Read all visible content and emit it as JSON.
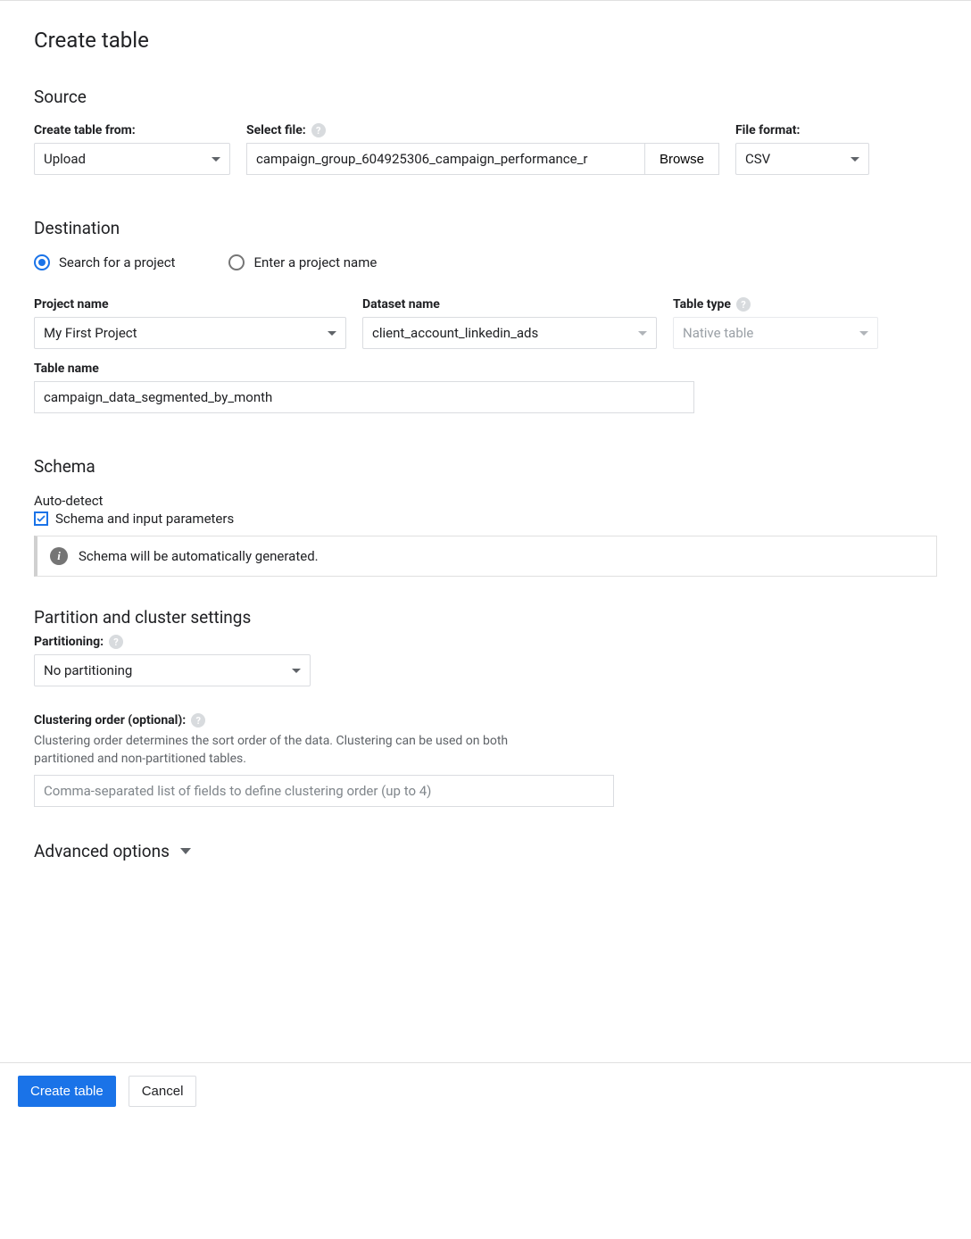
{
  "title": "Create table",
  "source": {
    "heading": "Source",
    "create_from_label": "Create table from:",
    "create_from_value": "Upload",
    "select_file_label": "Select file:",
    "select_file_value": "campaign_group_604925306_campaign_performance_r",
    "browse_label": "Browse",
    "file_format_label": "File format:",
    "file_format_value": "CSV"
  },
  "destination": {
    "heading": "Destination",
    "radio_search": "Search for a project",
    "radio_enter": "Enter a project name",
    "project_label": "Project name",
    "project_value": "My First Project",
    "dataset_label": "Dataset name",
    "dataset_value": "client_account_linkedin_ads",
    "table_type_label": "Table type",
    "table_type_value": "Native table",
    "table_name_label": "Table name",
    "table_name_value": "campaign_data_segmented_by_month"
  },
  "schema": {
    "heading": "Schema",
    "autodetect_label": "Auto-detect",
    "autodetect_checkbox": "Schema and input parameters",
    "info_text": "Schema will be automatically generated."
  },
  "partition": {
    "heading": "Partition and cluster settings",
    "partitioning_label": "Partitioning:",
    "partitioning_value": "No partitioning",
    "clustering_label": "Clustering order (optional):",
    "clustering_hint": "Clustering order determines the sort order of the data. Clustering can be used on both partitioned and non-partitioned tables.",
    "clustering_placeholder": "Comma-separated list of fields to define clustering order (up to 4)"
  },
  "advanced": {
    "label": "Advanced options"
  },
  "footer": {
    "create": "Create table",
    "cancel": "Cancel"
  }
}
